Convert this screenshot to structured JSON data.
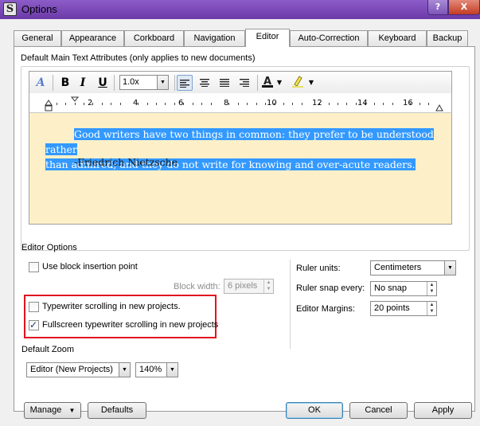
{
  "window": {
    "title": "Options",
    "help_glyph": "?",
    "close_glyph": "X"
  },
  "tabs": [
    {
      "label": "General"
    },
    {
      "label": "Appearance"
    },
    {
      "label": "Corkboard"
    },
    {
      "label": "Navigation"
    },
    {
      "label": "Editor",
      "active": true
    },
    {
      "label": "Auto-Correction"
    },
    {
      "label": "Keyboard"
    },
    {
      "label": "Backup"
    }
  ],
  "main_text": {
    "group_label": "Default Main Text Attributes (only applies to new documents)",
    "toolbar": {
      "font_glyph": "A",
      "bold": "B",
      "italic": "I",
      "underline": "U",
      "line_spacing": "1.0x"
    },
    "ruler": {
      "numbers": [
        "2",
        "4",
        "6",
        "8",
        "10",
        "12",
        "14",
        "16"
      ]
    },
    "sample_line_1": "Good writers have two things in common: they prefer to be understood rather",
    "sample_line_2": "than admired; and they do not write for knowing and over-acute readers.",
    "attribution": "-Friedrich Nietzsche",
    "text_area_color": "#fdf0c8",
    "selection_color": "#3399ff"
  },
  "editor_options": {
    "group_label": "Editor Options",
    "use_block_insertion": {
      "label": "Use block insertion point",
      "checked": false
    },
    "block_width": {
      "label": "Block width:",
      "value": "6 pixels",
      "disabled": true
    },
    "typewriter_scrolling": {
      "label": "Typewriter scrolling in new projects.",
      "checked": false
    },
    "fullscreen_typewriter": {
      "label": "Fullscreen typewriter scrolling in new projects",
      "checked": true
    },
    "ruler_units": {
      "label": "Ruler units:",
      "value": "Centimeters"
    },
    "ruler_snap": {
      "label": "Ruler snap every:",
      "value": "No snap"
    },
    "editor_margins": {
      "label": "Editor Margins:",
      "value": "20 points"
    },
    "highlight_color": "#e0141e"
  },
  "default_zoom": {
    "group_label": "Default Zoom",
    "mode": "Editor (New Projects)",
    "zoom": "140%"
  },
  "footer": {
    "manage": "Manage",
    "defaults": "Defaults",
    "ok": "OK",
    "cancel": "Cancel",
    "apply": "Apply"
  }
}
